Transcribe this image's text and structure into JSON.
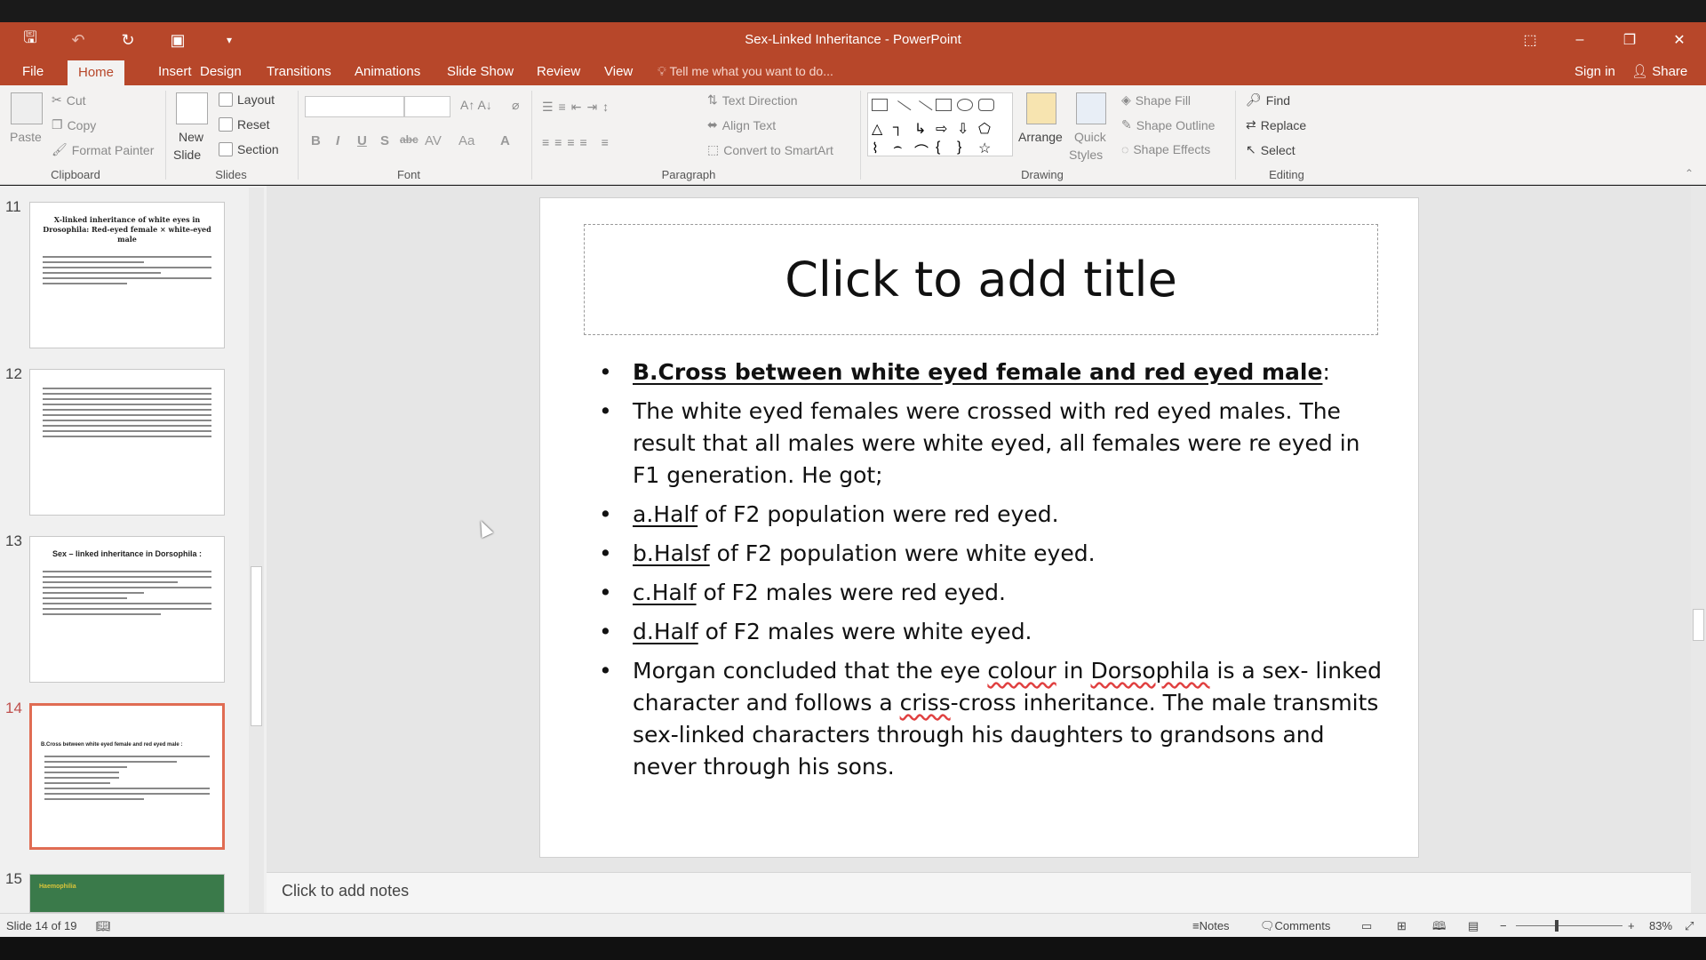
{
  "window": {
    "title": "Sex-Linked Inheritance - PowerPoint"
  },
  "quick_access": [
    "save-icon",
    "undo-icon",
    "redo-icon",
    "present-icon",
    "customize-icon"
  ],
  "tabs": [
    {
      "label": "File"
    },
    {
      "label": "Home"
    },
    {
      "label": "Insert"
    },
    {
      "label": "Design"
    },
    {
      "label": "Transitions"
    },
    {
      "label": "Animations"
    },
    {
      "label": "Slide Show"
    },
    {
      "label": "Review"
    },
    {
      "label": "View"
    }
  ],
  "tellme": "Tell me what you want to do...",
  "account": {
    "signin": "Sign in",
    "share": "Share"
  },
  "ribbon": {
    "clipboard": {
      "paste": "Paste",
      "cut": "Cut",
      "copy": "Copy",
      "format_painter": "Format Painter",
      "label": "Clipboard"
    },
    "slides": {
      "new_slide_1": "New",
      "new_slide_2": "Slide",
      "layout": "Layout",
      "reset": "Reset",
      "section": "Section",
      "label": "Slides"
    },
    "font": {
      "label": "Font",
      "bold": "B",
      "italic": "I",
      "underline": "U",
      "shadow": "S",
      "strike": "abc",
      "spacing": "AV",
      "case": "Aa",
      "color": "A"
    },
    "paragraph": {
      "text_direction": "Text Direction",
      "align_text": "Align Text",
      "convert": "Convert to SmartArt",
      "label": "Paragraph"
    },
    "drawing": {
      "arrange": "Arrange",
      "quick_styles_1": "Quick",
      "quick_styles_2": "Styles",
      "shape_fill": "Shape Fill",
      "shape_outline": "Shape Outline",
      "shape_effects": "Shape Effects",
      "label": "Drawing"
    },
    "editing": {
      "find": "Find",
      "replace": "Replace",
      "select": "Select",
      "label": "Editing"
    }
  },
  "thumbnails": [
    {
      "num": "11",
      "title": "X-linked inheritance of white eyes in Drosophila: Red-eyed female × white-eyed male"
    },
    {
      "num": "12",
      "title": ""
    },
    {
      "num": "13",
      "title": "Sex – linked inheritance in Dorsophila :"
    },
    {
      "num": "14",
      "title": "B.Cross between white eyed female and red eyed male :"
    },
    {
      "num": "15",
      "title": "Haemophilia"
    }
  ],
  "slide": {
    "title_placeholder": "Click to add title",
    "bullets": {
      "b1_bold": "B.Cross between white eyed female and red eyed male",
      "b1_end": ":",
      "b2": "The white eyed females were crossed with red eyed males. The result that all males were white eyed, all females were re eyed in F1 generation. He got;",
      "b3_a": "a.Half",
      "b3_b": " of F2 population were red eyed.",
      "b4_a": "b.Halsf",
      "b4_b": " of F2 population were white eyed.",
      "b5_a": "c.Half",
      "b5_b": " of F2 males were red eyed.",
      "b6_a": "d.Half",
      "b6_b": " of F2 males were white eyed.",
      "b7_1": "Morgan concluded that the eye ",
      "b7_2": "colour",
      "b7_3": " in ",
      "b7_4": "Dorsophila",
      "b7_5": " is a sex- linked character and follows a ",
      "b7_6": "criss",
      "b7_7": "-cross inheritance. The male transmits sex-linked characters through his daughters to grandsons and never through his sons."
    }
  },
  "notes_placeholder": "Click to add notes",
  "status": {
    "slide": "Slide 14 of 19",
    "notes": "Notes",
    "comments": "Comments",
    "zoom": "83%"
  }
}
